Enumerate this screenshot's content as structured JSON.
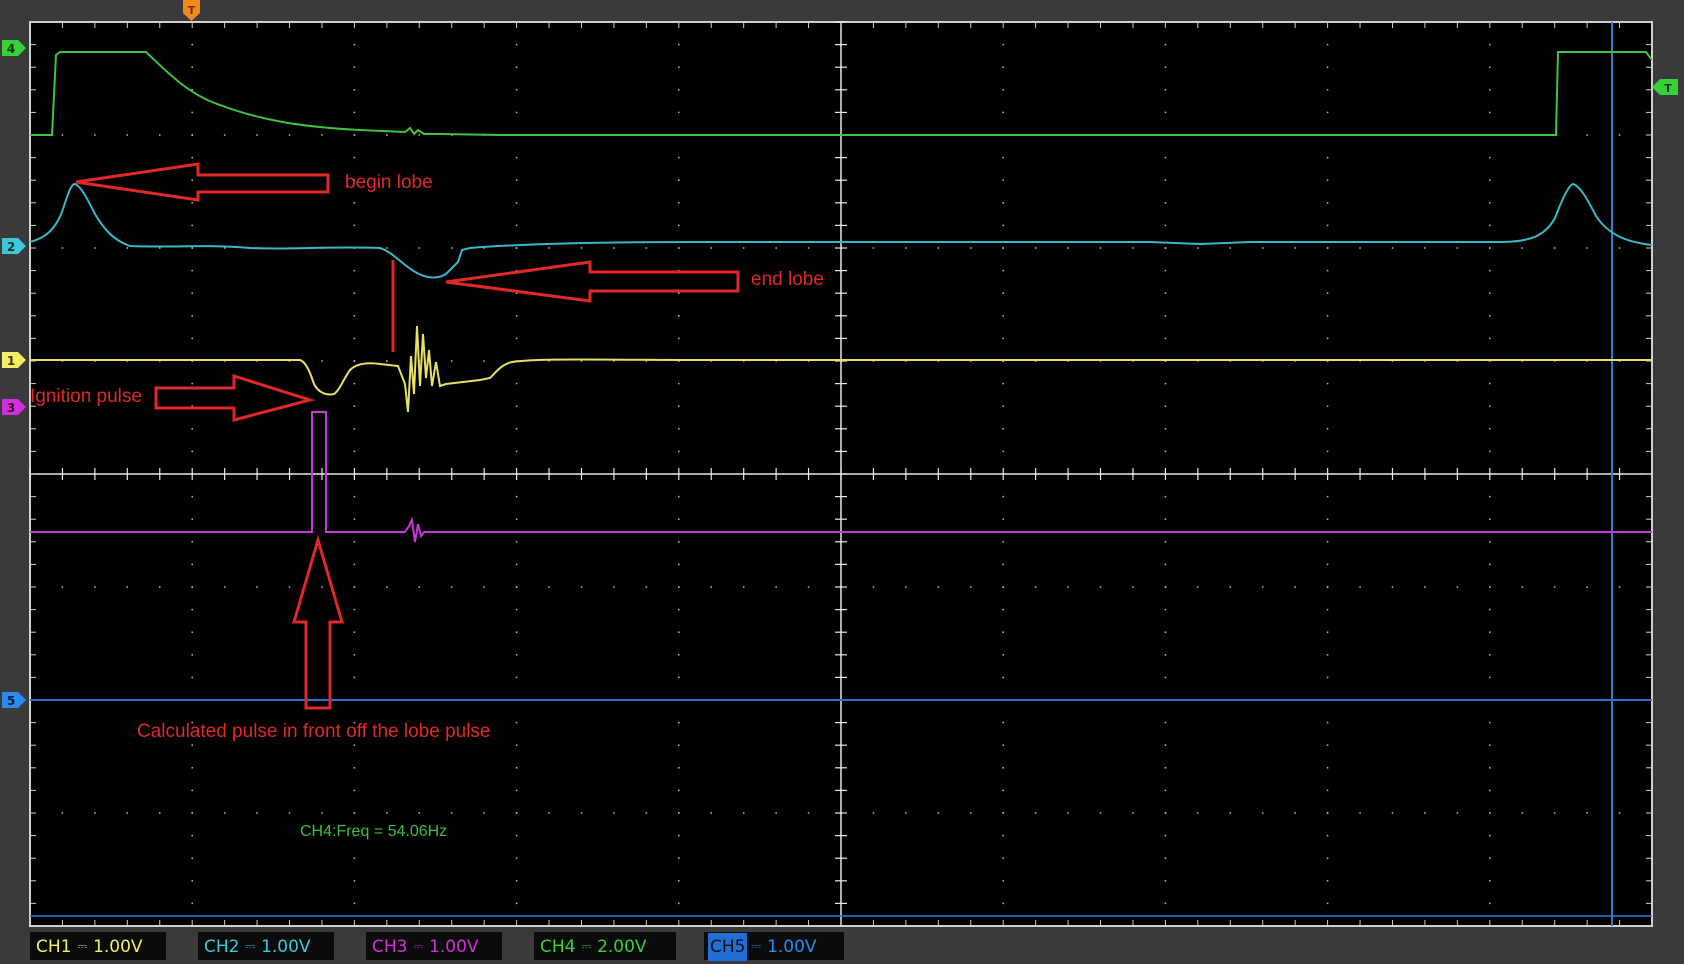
{
  "markers": {
    "trigger_top": "T",
    "trigger_right": "T",
    "ch4": "4",
    "ch2": "2",
    "ch1": "1",
    "ch3": "3",
    "ch5": "5"
  },
  "annotations": {
    "begin_lobe": "begin lobe",
    "end_lobe": "end lobe",
    "ignition_pulse": "Ignition pulse",
    "calculated_pulse": "Calculated pulse in front off the lobe pulse"
  },
  "measurement": "CH4:Freq = 54.06Hz",
  "channels": [
    {
      "name": "CH1",
      "coupling": "DC",
      "volts": "1.00V",
      "color": "#f2ee6a"
    },
    {
      "name": "CH2",
      "coupling": "DC",
      "volts": "1.00V",
      "color": "#3cc8d8"
    },
    {
      "name": "CH3",
      "coupling": "DC",
      "volts": "1.00V",
      "color": "#d030d8"
    },
    {
      "name": "CH4",
      "coupling": "DC",
      "volts": "2.00V",
      "color": "#38d038"
    },
    {
      "name": "CH5",
      "coupling": "DC",
      "volts": "1.00V",
      "color": "#2a8cf0"
    }
  ],
  "colors": {
    "ch4_trace": "#3ec43e",
    "ch2_trace": "#38b8c8",
    "ch1_trace": "#e8e060",
    "ch3_trace": "#c838d8",
    "ch5_trace": "#2a6fd8",
    "annotation": "#e02828",
    "grid": "#e8e8e8",
    "trigger_marker": "#f08a1a",
    "cursor": "#2a7fd0"
  }
}
